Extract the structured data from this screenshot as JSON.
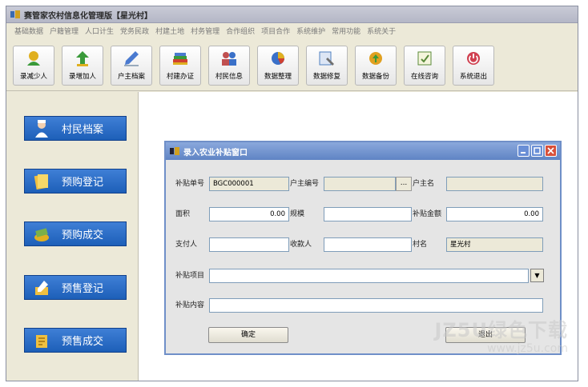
{
  "window": {
    "title": "赛管家农村信息化管理版【星光村】"
  },
  "menu": [
    "基础数据",
    "户籍管理",
    "人口计生",
    "党务民政",
    "村建土地",
    "村务管理",
    "合作组织",
    "项目合作",
    "系统维护",
    "常用功能",
    "系统关于"
  ],
  "toolbar": [
    {
      "label": "录减少人",
      "icon": "person-minus-icon",
      "color": "#e0b020"
    },
    {
      "label": "录增加人",
      "icon": "person-add-icon",
      "color": "#3a9a3a"
    },
    {
      "label": "户主档案",
      "icon": "pen-icon",
      "color": "#4a7ad0"
    },
    {
      "label": "村建办证",
      "icon": "books-icon",
      "color": "#d04030"
    },
    {
      "label": "村民信息",
      "icon": "people-icon",
      "color": "#c05050"
    },
    {
      "label": "数据整理",
      "icon": "chart-icon",
      "color": "#3a70c8"
    },
    {
      "label": "数据修复",
      "icon": "repair-icon",
      "color": "#5080c0"
    },
    {
      "label": "数据备份",
      "icon": "backup-icon",
      "color": "#e0a020"
    },
    {
      "label": "在线咨询",
      "icon": "consult-icon",
      "color": "#5a8a3a"
    },
    {
      "label": "系统退出",
      "icon": "exit-icon",
      "color": "#d04050"
    }
  ],
  "sidebar": [
    {
      "label": "村民档案",
      "icon": "nurse-icon"
    },
    {
      "label": "预购登记",
      "icon": "notes-icon"
    },
    {
      "label": "预购成交",
      "icon": "money-icon"
    },
    {
      "label": "预售登记",
      "icon": "sign-icon"
    },
    {
      "label": "预售成交",
      "icon": "deal-icon"
    }
  ],
  "dialog": {
    "title": "录入农业补贴窗口",
    "labels": {
      "subsidy_no": "补贴单号",
      "household_no": "户主编号",
      "household_name": "户主名",
      "area": "面积",
      "scale": "规模",
      "amount": "补贴金额",
      "payer": "支付人",
      "payee": "收款人",
      "village": "村名",
      "project": "补贴项目",
      "content": "补贴内容"
    },
    "values": {
      "subsidy_no": "BGC000001",
      "household_no": "",
      "household_name": "",
      "area": "0.00",
      "scale": "",
      "amount": "0.00",
      "payer": "",
      "payee": "",
      "village": "星光村",
      "project": "",
      "content": ""
    },
    "ellipsis": "...",
    "combo_arrow": "▼",
    "ok": "确定",
    "exit": "退出"
  },
  "watermark": {
    "main": "JZ5U绿色下载",
    "url": "www.jz5u.com"
  }
}
